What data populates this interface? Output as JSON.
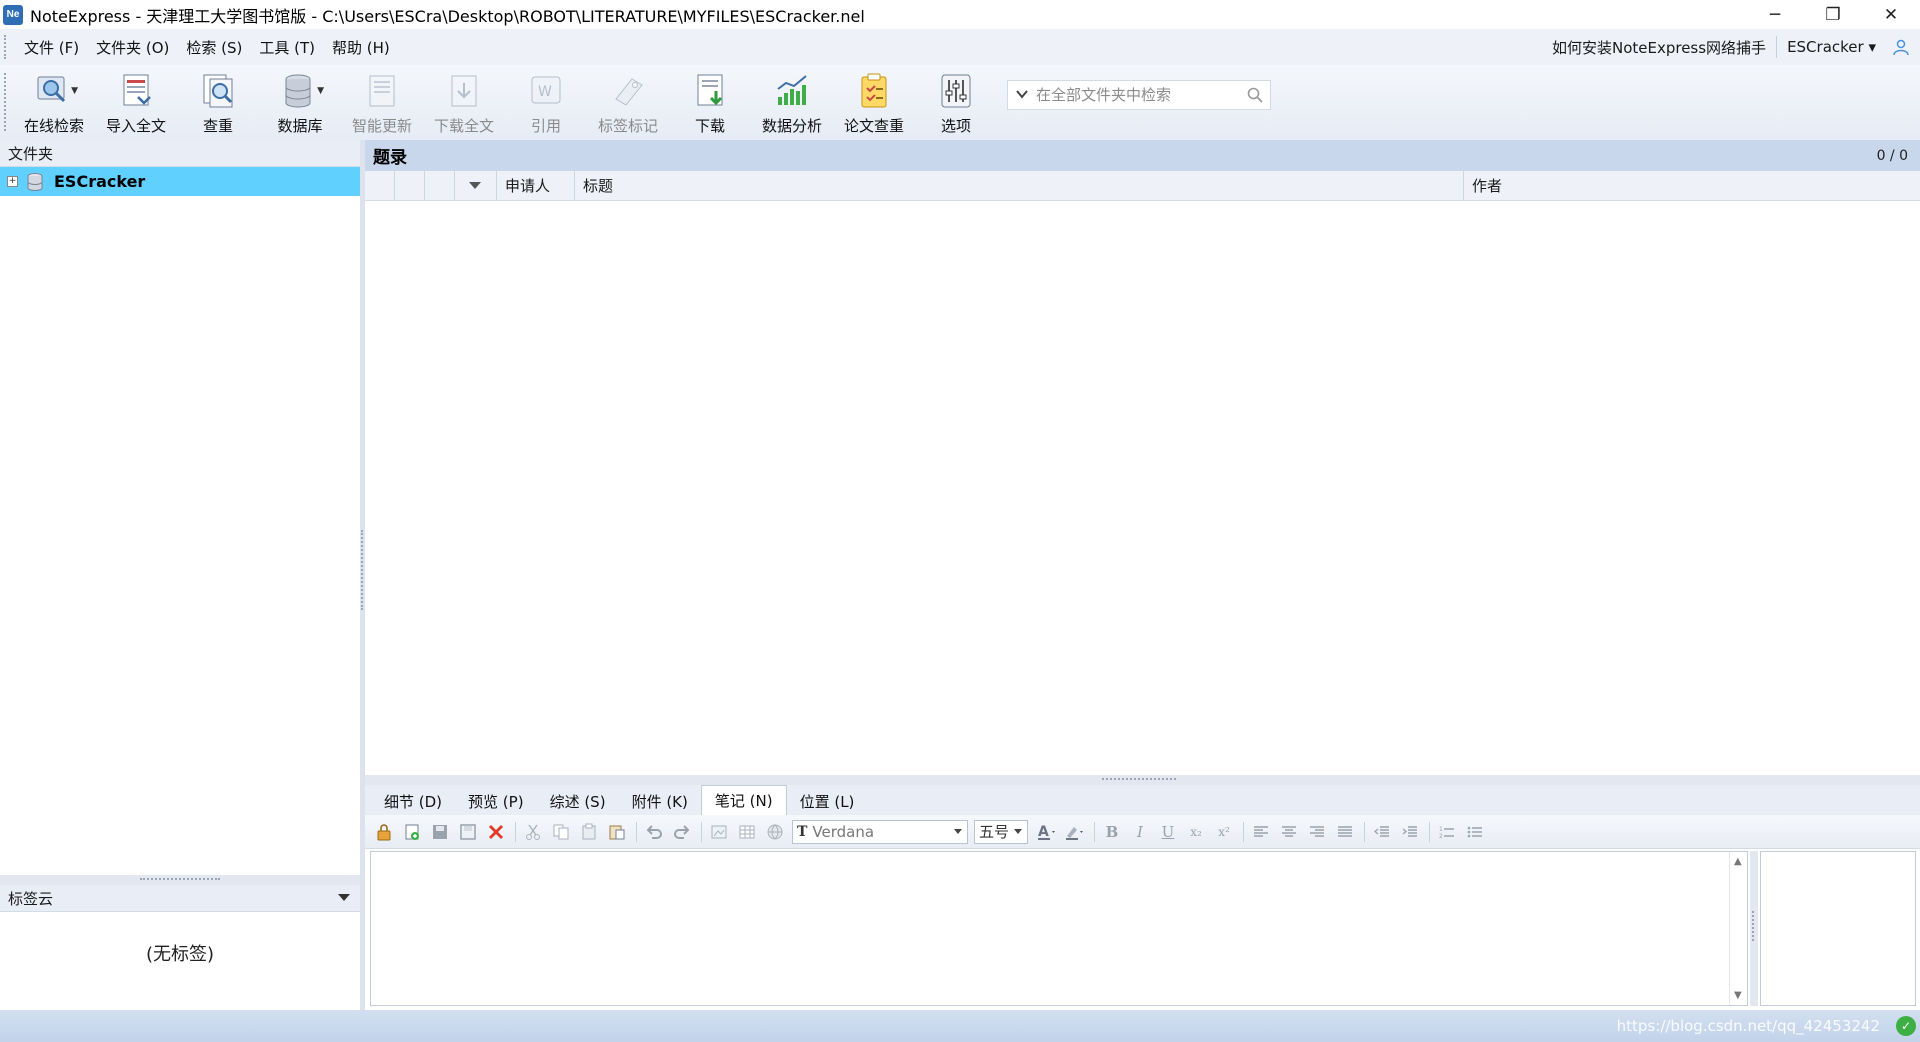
{
  "window": {
    "app_icon": "Ne",
    "title": "NoteExpress - 天津理工大学图书馆版 - C:\\Users\\ESCra\\Desktop\\ROBOT\\LITERATURE\\MYFILES\\ESCracker.nel",
    "minimize": "─",
    "restore": "❐",
    "close": "✕"
  },
  "menubar": {
    "items": [
      "文件 (F)",
      "文件夹 (O)",
      "检索 (S)",
      "工具 (T)",
      "帮助 (H)"
    ],
    "link": "如何安装NoteExpress网络捕手",
    "user": "ESCracker ▾"
  },
  "toolbar": {
    "buttons": [
      {
        "label": "在线检索",
        "icon": "online-search-icon",
        "enabled": true,
        "dropdown": true
      },
      {
        "label": "导入全文",
        "icon": "import-fulltext-icon",
        "enabled": true
      },
      {
        "label": "查重",
        "icon": "duplicate-check-icon",
        "enabled": true
      },
      {
        "label": "数据库",
        "icon": "database-icon",
        "enabled": true,
        "dropdown": true
      },
      {
        "label": "智能更新",
        "icon": "smart-update-icon",
        "enabled": false
      },
      {
        "label": "下载全文",
        "icon": "download-fulltext-icon",
        "enabled": false
      },
      {
        "label": "引用",
        "icon": "cite-icon",
        "enabled": false
      },
      {
        "label": "标签标记",
        "icon": "tag-icon",
        "enabled": false
      },
      {
        "label": "下载",
        "icon": "download-icon",
        "enabled": true
      },
      {
        "label": "数据分析",
        "icon": "data-analysis-icon",
        "enabled": true
      },
      {
        "label": "论文查重",
        "icon": "paper-check-icon",
        "enabled": true
      },
      {
        "label": "选项",
        "icon": "options-icon",
        "enabled": true
      }
    ],
    "search_placeholder": "在全部文件夹中检索"
  },
  "left_pane": {
    "header": "文件夹",
    "tree": [
      {
        "label": "ESCracker",
        "expander": "+",
        "selected": true
      }
    ],
    "tag_header": "标签云",
    "tag_empty": "(无标签)"
  },
  "main": {
    "title": "题录",
    "count": "0 / 0",
    "columns": [
      "申请人",
      "标题",
      "作者"
    ]
  },
  "tabs": [
    "细节 (D)",
    "预览 (P)",
    "综述 (S)",
    "附件 (K)",
    "笔记 (N)",
    "位置 (L)"
  ],
  "editor": {
    "font_tag": "T",
    "font": "Verdana",
    "size": "五号",
    "format_glyphs": {
      "bold": "B",
      "italic": "I",
      "underline": "U",
      "subscript": "x₂",
      "superscript": "x²"
    }
  },
  "statusbar": {
    "watermark": "https://blog.csdn.net/qq_42453242",
    "status_icon": "✓"
  },
  "colors": {
    "selected_tree_item": "#5fd0ff",
    "main_header": "#c8d7ec",
    "status_ok": "#3cb043"
  }
}
